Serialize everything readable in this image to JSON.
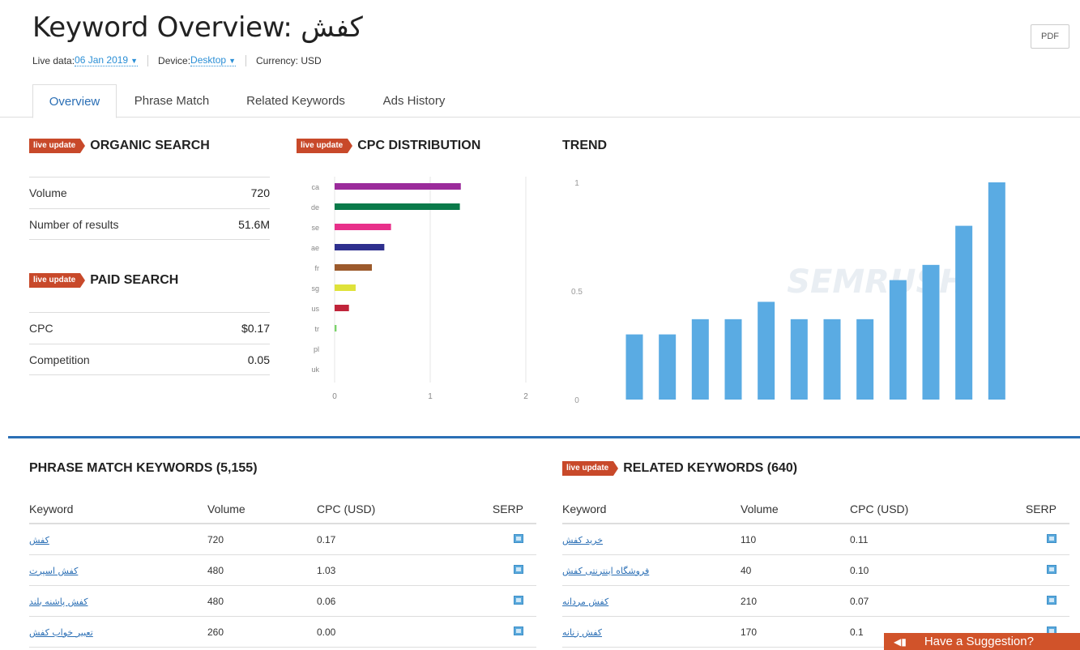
{
  "header": {
    "title_prefix": "Keyword Overview: ",
    "keyword": "کفش",
    "pdf_label": "PDF"
  },
  "meta": {
    "live_label": "Live data: ",
    "live_value": "06 Jan 2019",
    "device_label": "Device: ",
    "device_value": "Desktop",
    "currency_label": "Currency: USD"
  },
  "tabs": [
    "Overview",
    "Phrase Match",
    "Related Keywords",
    "Ads History"
  ],
  "badge_text": "live update",
  "organic": {
    "title": "ORGANIC SEARCH",
    "rows": [
      {
        "label": "Volume",
        "value": "720"
      },
      {
        "label": "Number of results",
        "value": "51.6M"
      }
    ]
  },
  "paid": {
    "title": "PAID SEARCH",
    "rows": [
      {
        "label": "CPC",
        "value": "$0.17"
      },
      {
        "label": "Competition",
        "value": "0.05"
      }
    ]
  },
  "cpc_title": "CPC DISTRIBUTION",
  "trend_title": "TREND",
  "chart_data": [
    {
      "type": "bar",
      "orientation": "horizontal",
      "title": "CPC DISTRIBUTION",
      "categories": [
        "ca",
        "de",
        "se",
        "ae",
        "fr",
        "sg",
        "us",
        "tr",
        "pl",
        "uk"
      ],
      "values": [
        1.32,
        1.31,
        0.59,
        0.52,
        0.39,
        0.22,
        0.15,
        0.02,
        0,
        0
      ],
      "colors": [
        "#9b2b9b",
        "#0a7a4a",
        "#e8308a",
        "#2e2f8e",
        "#9c5a2c",
        "#dfe23a",
        "#c0243a",
        "#7bd36a",
        "#999999",
        "#999999"
      ],
      "xlim": [
        0,
        2
      ],
      "xticks": [
        "0",
        "1",
        "2"
      ],
      "grid": true
    },
    {
      "type": "bar",
      "title": "TREND",
      "values": [
        0.3,
        0.3,
        0.37,
        0.37,
        0.45,
        0.37,
        0.37,
        0.37,
        0.55,
        0.62,
        0.8,
        1.0
      ],
      "ylim": [
        0,
        1
      ],
      "yticks": [
        "0",
        "0.5",
        "1"
      ],
      "color": "#5aabe3",
      "watermark": "SEMRUSH"
    }
  ],
  "phrase_match": {
    "title": "PHRASE MATCH KEYWORDS (5,155)",
    "headers": [
      "Keyword",
      "Volume",
      "CPC (USD)",
      "SERP"
    ],
    "rows": [
      {
        "keyword": "کفش",
        "volume": "720",
        "cpc": "0.17"
      },
      {
        "keyword": "کفش اسپرت",
        "volume": "480",
        "cpc": "1.03"
      },
      {
        "keyword": "کفش پاشنه بلند",
        "volume": "480",
        "cpc": "0.06"
      },
      {
        "keyword": "تعبیر خواب کفش",
        "volume": "260",
        "cpc": "0.00"
      }
    ]
  },
  "related": {
    "title": "RELATED KEYWORDS (640)",
    "headers": [
      "Keyword",
      "Volume",
      "CPC (USD)",
      "SERP"
    ],
    "rows": [
      {
        "keyword": "خرید کفش",
        "volume": "110",
        "cpc": "0.11"
      },
      {
        "keyword": "فروشگاه اینترنتی کفش",
        "volume": "40",
        "cpc": "0.10"
      },
      {
        "keyword": "کفش مردانه",
        "volume": "210",
        "cpc": "0.07"
      },
      {
        "keyword": "کفش زنانه",
        "volume": "170",
        "cpc": "0.1"
      }
    ]
  },
  "suggestion": {
    "label": "Have a Suggestion?"
  }
}
